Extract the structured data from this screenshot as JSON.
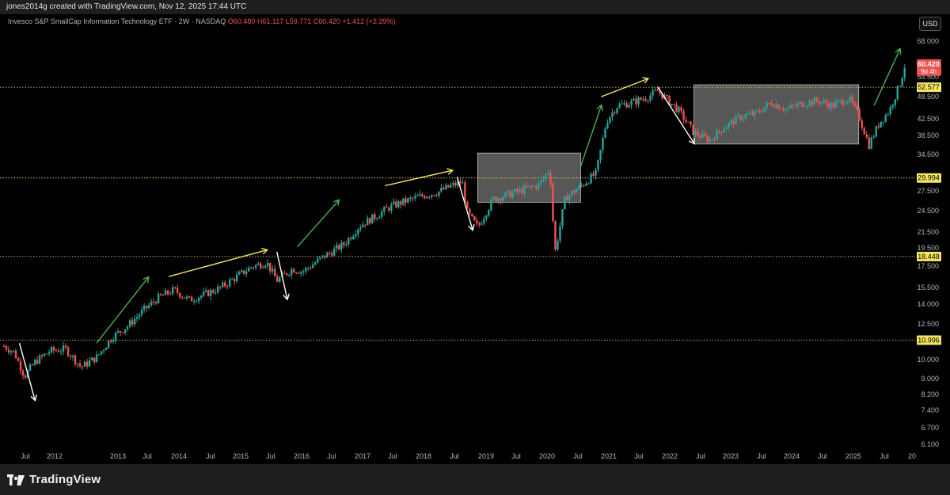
{
  "header": {
    "attribution": "jones2014g created with TradingView.com, Nov 12, 2025 17:44 UTC"
  },
  "symbol": {
    "name": "Invesco S&P SmallCap Information Technology ETF · 2W · NASDAQ",
    "open": "O60.480",
    "high": "H61.117",
    "low": "L59.771",
    "close": "C60.420",
    "change": "+1.412 (+2.39%)"
  },
  "currency_button": "USD",
  "price_axis": {
    "ticks": [
      "68.000",
      "54.500",
      "48.500",
      "42.500",
      "38.500",
      "34.500",
      "27.500",
      "24.500",
      "21.500",
      "19.500",
      "17.500",
      "15.500",
      "14.000",
      "12.500",
      "10.000",
      "9.000",
      "8.200",
      "7.400",
      "6.700",
      "6.100"
    ],
    "last_price": "60.420",
    "countdown": "9d 4h",
    "levels": [
      "52.577",
      "29.994",
      "18.448",
      "10.996"
    ]
  },
  "time_axis": {
    "labels": [
      "Jul",
      "2012",
      "2013",
      "Jul",
      "2014",
      "Jul",
      "2015",
      "Jul",
      "2016",
      "Jul",
      "2017",
      "Jul",
      "2018",
      "Jul",
      "2019",
      "Jul",
      "2020",
      "Jul",
      "2021",
      "Jul",
      "2022",
      "Jul",
      "2023",
      "Jul",
      "2024",
      "Jul",
      "2025",
      "Jul",
      "20"
    ]
  },
  "colors": {
    "up": "#26a69a",
    "down": "#ef5350",
    "level_line": "#f5e663",
    "level_label_bg": "#f5e663",
    "price_label_bg": "#ef5350",
    "green_arrow": "#4caf50",
    "yellow_arrow": "#f5e663",
    "white_arrow": "#ffffff",
    "range_box": "#9e9e9e"
  },
  "chart_data": {
    "type": "candlestick",
    "interval": "2W",
    "yscale": "log",
    "ylim": [
      5.8,
      72
    ],
    "xlim": [
      "2011-04",
      "2025-12"
    ],
    "series": [
      {
        "name": "",
        "x": [
          "2011-04",
          "2011-06",
          "2011-08",
          "2011-10",
          "2012-01",
          "2012-04",
          "2012-07",
          "2012-10",
          "2013-01",
          "2013-04",
          "2013-07",
          "2013-10",
          "2014-01",
          "2014-04",
          "2014-07",
          "2014-10",
          "2015-01",
          "2015-04",
          "2015-07",
          "2015-09",
          "2015-12",
          "2016-02",
          "2016-06",
          "2016-10",
          "2017-01",
          "2017-04",
          "2017-07",
          "2017-10",
          "2018-01",
          "2018-04",
          "2018-07",
          "2018-09",
          "2018-10",
          "2018-12",
          "2019-03",
          "2019-06",
          "2019-09",
          "2019-12",
          "2020-02",
          "2020-03",
          "2020-05",
          "2020-08",
          "2020-11",
          "2021-01",
          "2021-03",
          "2021-06",
          "2021-09",
          "2021-11",
          "2022-03",
          "2022-06",
          "2022-09",
          "2022-12",
          "2023-03",
          "2023-06",
          "2023-09",
          "2023-12",
          "2024-03",
          "2024-06",
          "2024-09",
          "2024-12",
          "2025-02",
          "2025-04",
          "2025-06",
          "2025-08",
          "2025-10",
          "2025-11"
        ],
        "y": [
          10.6,
          10.2,
          8.8,
          9.6,
          10.3,
          10.4,
          9.3,
          9.9,
          11.2,
          12.0,
          13.2,
          14.3,
          15.0,
          14.1,
          14.6,
          15.2,
          16.2,
          17.3,
          17.8,
          15.9,
          17.1,
          16.8,
          18.4,
          19.9,
          22.3,
          23.6,
          25.1,
          26.0,
          26.8,
          27.4,
          28.6,
          29.3,
          24.2,
          22.1,
          26.3,
          27.1,
          27.9,
          28.8,
          31.8,
          18.9,
          26.5,
          28.5,
          30.9,
          42.6,
          46.8,
          47.9,
          49.5,
          51.4,
          45.6,
          39.7,
          37.9,
          41.2,
          43.8,
          44.6,
          47.9,
          45.8,
          47.6,
          48.4,
          46.9,
          49.2,
          44.1,
          36.8,
          42.2,
          45.6,
          53.8,
          60.42
        ]
      }
    ],
    "levels": [
      52.577,
      29.994,
      18.448,
      10.996
    ],
    "annotations": [
      {
        "type": "arrow",
        "color": "white",
        "from": [
          "2011-07",
          10.8
        ],
        "to": [
          "2011-10",
          7.6
        ]
      },
      {
        "type": "arrow",
        "color": "green",
        "from": [
          "2012-10",
          10.8
        ],
        "to": [
          "2013-08",
          16.2
        ]
      },
      {
        "type": "arrow",
        "color": "yellow",
        "from": [
          "2013-12",
          16.3
        ],
        "to": [
          "2015-07",
          19.2
        ]
      },
      {
        "type": "arrow",
        "color": "white",
        "from": [
          "2015-09",
          19.0
        ],
        "to": [
          "2015-11",
          14.2
        ]
      },
      {
        "type": "arrow",
        "color": "green",
        "from": [
          "2016-01",
          19.6
        ],
        "to": [
          "2016-09",
          26.1
        ]
      },
      {
        "type": "arrow",
        "color": "yellow",
        "from": [
          "2017-06",
          28.6
        ],
        "to": [
          "2018-07",
          31.4
        ]
      },
      {
        "type": "arrow",
        "color": "white",
        "from": [
          "2018-08",
          30.2
        ],
        "to": [
          "2018-11",
          21.8
        ]
      },
      {
        "type": "arrow",
        "color": "green",
        "from": [
          "2020-08",
          32.2
        ],
        "to": [
          "2021-00",
          46.9
        ]
      },
      {
        "type": "arrow",
        "color": "yellow",
        "from": [
          "2021-00",
          49.6
        ],
        "to": [
          "2021-09",
          55.4
        ]
      },
      {
        "type": "arrow",
        "color": "white",
        "from": [
          "2021-11",
          52.6
        ],
        "to": [
          "2022-06",
          37.2
        ]
      },
      {
        "type": "arrow",
        "color": "green",
        "from": [
          "2025-05",
          47.0
        ],
        "to": [
          "2025-10",
          66.5
        ]
      },
      {
        "type": "box",
        "from": [
          "2018-12",
          35.0
        ],
        "to": [
          "2020-08",
          25.8
        ]
      },
      {
        "type": "box",
        "from": [
          "2022-06",
          53.4
        ],
        "to": [
          "2025-02",
          37.0
        ]
      }
    ]
  }
}
